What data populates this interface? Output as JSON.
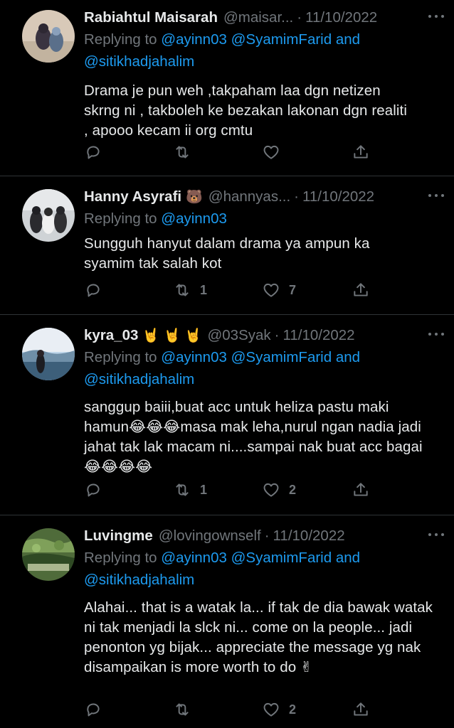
{
  "tweets": [
    {
      "name": "Rabiahtul Maisarah",
      "emoji": "",
      "handle": "@maisar...",
      "date": "11/10/2022",
      "replying_prefix": "Replying to ",
      "mentions": [
        "@ayinn03 @SyamimFarid and",
        "@sitikhadjahalim"
      ],
      "text": "Drama je pun weh ,takpaham laa dgn netizen skrng ni , takboleh ke bezakan lakonan dgn realiti , apooo kecam ii org cmtu",
      "retweets": "",
      "likes": ""
    },
    {
      "name": "Hanny Asyrafi",
      "emoji": "🐻",
      "handle": "@hannyas...",
      "date": "11/10/2022",
      "replying_prefix": "Replying to ",
      "mentions": [
        "@ayinn03"
      ],
      "text": "Sungguh hanyut dalam drama ya ampun ka syamim tak salah kot",
      "retweets": "1",
      "likes": "7"
    },
    {
      "name": "kyra_03",
      "emoji": "🤘 🤘 🤘",
      "handle": "@03Syak",
      "date": "11/10/2022",
      "replying_prefix": "Replying to ",
      "mentions": [
        "@ayinn03 @SyamimFarid and",
        "@sitikhadjahalim"
      ],
      "text": "sanggup baiii,buat acc untuk heliza pastu maki hamun😂😂😂masa mak leha,nurul ngan nadia jadi jahat tak lak macam ni....sampai nak buat acc bagai😂😂😂😂",
      "retweets": "1",
      "likes": "2"
    },
    {
      "name": "Luvingme",
      "emoji": "",
      "handle": "@lovingownself",
      "date": "11/10/2022",
      "replying_prefix": "Replying to ",
      "mentions": [
        "@ayinn03 @SyamimFarid and",
        "@sitikhadjahalim"
      ],
      "text": "Alahai... that is a watak la... if tak de dia bawak watak ni tak menjadi la slck ni... come on la people... jadi penonton yg bijak... appreciate the message yg nak disampaikan is more worth to do ✌",
      "retweets": "",
      "likes": "2"
    }
  ],
  "separator": "·",
  "icons": {
    "reply": "reply-icon",
    "retweet": "retweet-icon",
    "like": "heart-icon",
    "share": "share-icon",
    "more": "more-options-icon"
  },
  "colors": {
    "background": "#000000",
    "text": "#e7e9ea",
    "secondary": "#71767b",
    "link": "#1d9bf0",
    "divider": "#2f3336"
  }
}
